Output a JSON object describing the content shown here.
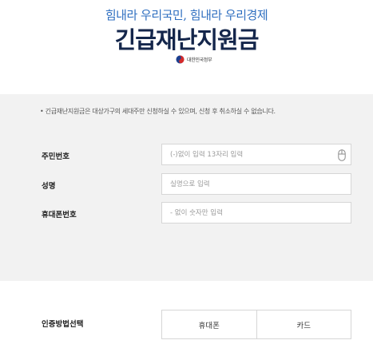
{
  "header": {
    "slogan": "힘내라 우리국민, 힘내라 우리경제",
    "title": "긴급재난지원금",
    "gov_name": "대한민국정부"
  },
  "form": {
    "notice": "•  긴급재난지원금은 대상가구의 세대주만 신청하실 수 있으며, 신청 후 취소하실 수 없습니다.",
    "fields": [
      {
        "label": "주민번호",
        "placeholder": "(-)없이 입력 13자리 입력",
        "value": ""
      },
      {
        "label": "성명",
        "placeholder": "실명으로 입력",
        "value": ""
      },
      {
        "label": "휴대폰번호",
        "placeholder": "- 없이 숫자만 입력",
        "value": ""
      }
    ]
  },
  "auth": {
    "label": "인증방법선택",
    "options": [
      "휴대폰",
      "카드"
    ]
  },
  "colors": {
    "slogan": "#2f6fc0",
    "title": "#14264b",
    "form_bg": "#f2f2f2"
  },
  "icons": {
    "emblem": "taegeuk-emblem-icon",
    "field_icon": "mouse-icon"
  }
}
